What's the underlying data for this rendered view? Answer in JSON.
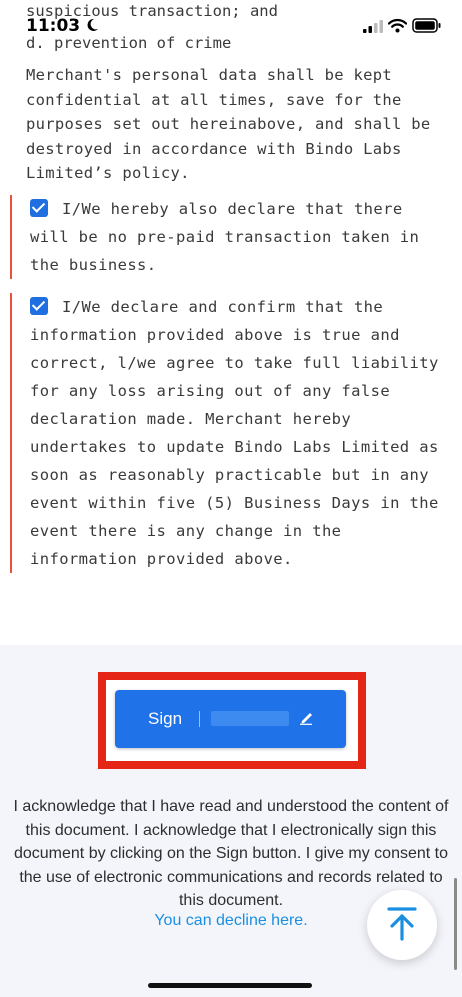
{
  "status_bar": {
    "time": "11:03"
  },
  "document": {
    "top_line_1": "suspicious transaction; and",
    "top_line_2": "d. prevention of crime",
    "paragraph": "Merchant's personal data shall be kept confidential at all times, save for the purposes set out hereinabove, and shall be destroyed in accordance with Bindo Labs Limited’s policy.",
    "declaration_1": {
      "checked": true,
      "text": "I/We hereby also declare that there will be no pre-paid transaction taken in the business."
    },
    "declaration_2": {
      "checked": true,
      "text": "I/We declare and confirm that the information provided above is true and correct, l/we agree to take full liability for any loss arising out of any false declaration made. Merchant hereby undertakes to update Bindo Labs Limited as soon as reasonably practicable but in any event within five (5) Business Days in the event there is any change in the information provided above."
    }
  },
  "sign": {
    "label": "Sign"
  },
  "acknowledgement": {
    "text": "I acknowledge that I have read and understood the content of this document. I acknowledge that I electronically sign this document by clicking on the Sign button. I give my consent to the use of electronic communications and records related to this document.",
    "decline_link": "You can decline here."
  },
  "colors": {
    "accent": "#1f72e8",
    "highlight_frame": "#e52616",
    "declaration_border": "#e8513a",
    "link": "#1a8fe0"
  }
}
